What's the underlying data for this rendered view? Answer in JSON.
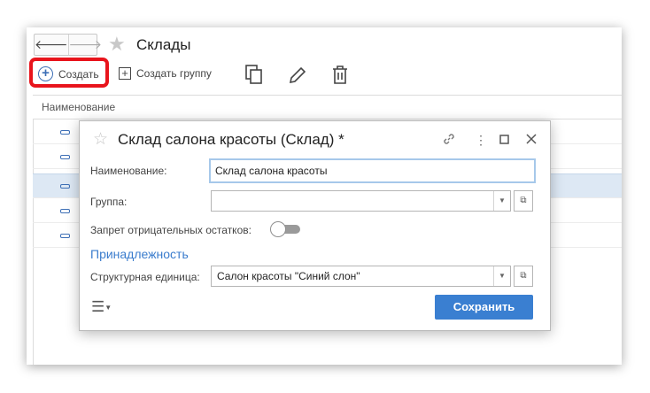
{
  "window": {
    "title": "Склады",
    "nav": {
      "back": "🡐",
      "forward": "🡒"
    }
  },
  "toolbar": {
    "create_label": "Создать",
    "create_group_label": "Создать группу",
    "copy_icon": "copy-icon",
    "edit_icon": "pencil-icon",
    "delete_icon": "trash-icon"
  },
  "grid": {
    "column_header": "Наименование",
    "row_count": 5
  },
  "dialog": {
    "title": "Склад салона красоты (Склад) *",
    "fields": {
      "name_label": "Наименование:",
      "name_value": "Склад салона красоты",
      "group_label": "Группа:",
      "group_value": "",
      "negative_label": "Запрет отрицательных остатков:",
      "negative_enabled": false,
      "section_title": "Принадлежность",
      "unit_label": "Структурная единица:",
      "unit_value": "Салон красоты \"Синий слон\""
    },
    "save_label": "Сохранить"
  },
  "colors": {
    "accent": "#3a7fd1",
    "highlight": "#e8141c",
    "selected_row": "#dde8f4"
  }
}
